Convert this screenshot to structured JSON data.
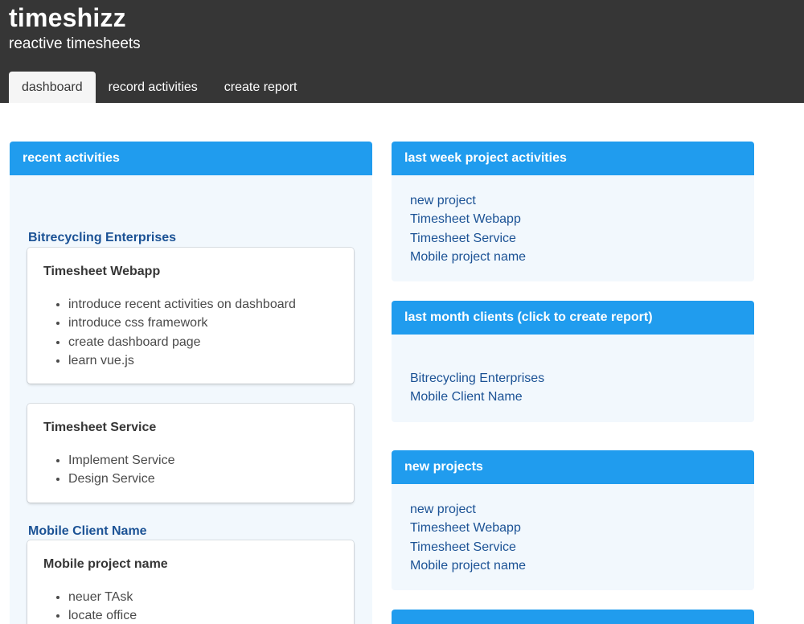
{
  "app": {
    "title": "timeshizz",
    "subtitle": "reactive timesheets"
  },
  "tabs": [
    {
      "label": "dashboard",
      "active": true
    },
    {
      "label": "record activities",
      "active": false
    },
    {
      "label": "create report",
      "active": false
    }
  ],
  "recent_activities": {
    "heading": "recent activities",
    "clients": [
      {
        "name": "Bitrecycling Enterprises",
        "projects": [
          {
            "name": "Timesheet Webapp",
            "tasks": [
              "introduce recent activities on dashboard",
              "introduce css framework",
              "create dashboard page",
              "learn vue.js"
            ]
          },
          {
            "name": "Timesheet Service",
            "tasks": [
              "Implement Service",
              "Design Service"
            ]
          }
        ]
      },
      {
        "name": "Mobile Client Name",
        "projects": [
          {
            "name": "Mobile project name",
            "tasks": [
              "neuer TAsk",
              "locate office"
            ]
          }
        ]
      }
    ]
  },
  "last_week_projects": {
    "heading": "last week project activities",
    "items": [
      "new project",
      "Timesheet Webapp",
      "Timesheet Service",
      "Mobile project name"
    ]
  },
  "last_month_clients": {
    "heading": "last month clients (click to create report)",
    "items": [
      "Bitrecycling Enterprises",
      "Mobile Client Name"
    ]
  },
  "new_projects": {
    "heading": "new projects",
    "items": [
      "new project",
      "Timesheet Webapp",
      "Timesheet Service",
      "Mobile project name"
    ]
  },
  "colors": {
    "header_bg": "#363636",
    "panel_heading": "#209cee",
    "panel_body": "#f2f8fd",
    "link": "#1b5295"
  }
}
